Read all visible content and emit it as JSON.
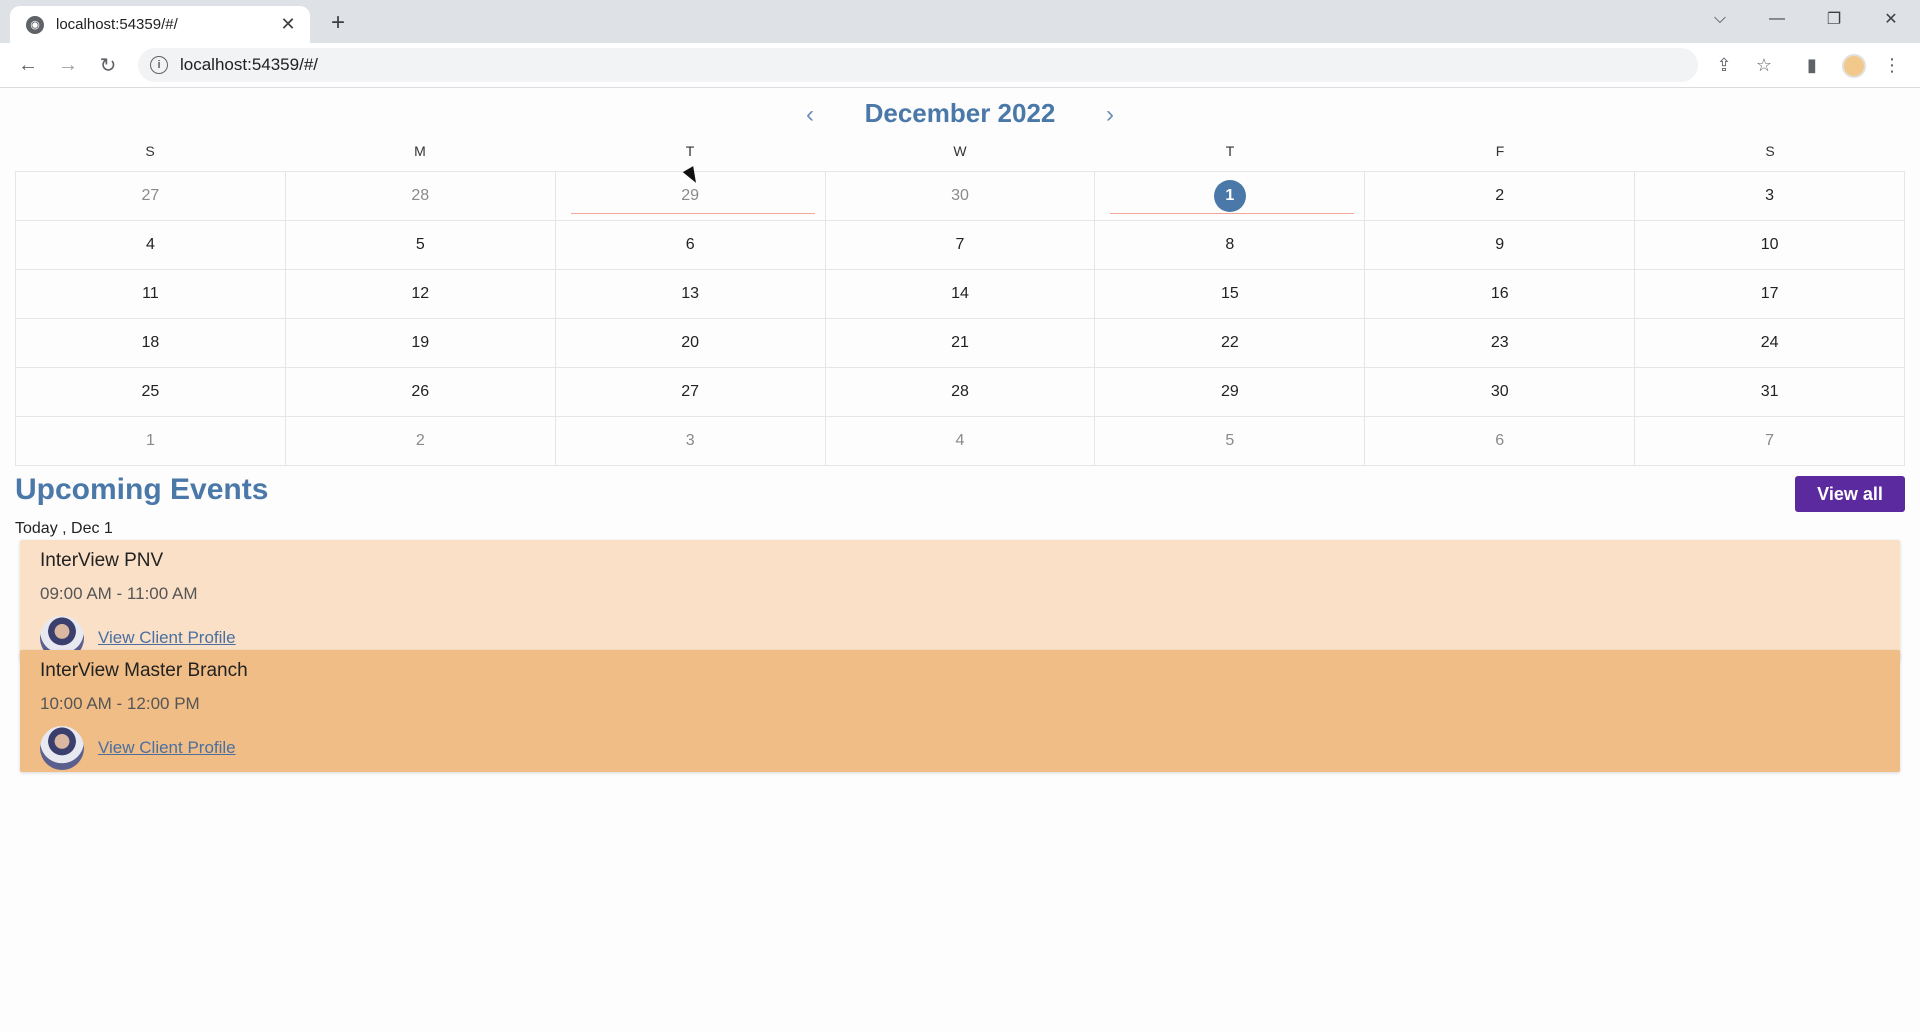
{
  "browser": {
    "tab_title": "localhost:54359/#/",
    "tab_close": "✕",
    "new_tab": "+",
    "url": "localhost:54359/#/",
    "window": {
      "tabsearch": "⌵",
      "minimize": "—",
      "restore": "❐",
      "close": "✕"
    }
  },
  "calendar": {
    "title": "December 2022",
    "prev": "‹",
    "next": "›",
    "weekdays": [
      "S",
      "M",
      "T",
      "W",
      "T",
      "F",
      "S"
    ],
    "weeks": [
      [
        "27",
        "28",
        "29",
        "30",
        "1",
        "2",
        "3"
      ],
      [
        "4",
        "5",
        "6",
        "7",
        "8",
        "9",
        "10"
      ],
      [
        "11",
        "12",
        "13",
        "14",
        "15",
        "16",
        "17"
      ],
      [
        "18",
        "19",
        "20",
        "21",
        "22",
        "23",
        "24"
      ],
      [
        "25",
        "26",
        "27",
        "28",
        "29",
        "30",
        "31"
      ],
      [
        "1",
        "2",
        "3",
        "4",
        "5",
        "6",
        "7"
      ]
    ]
  },
  "events": {
    "title": "Upcoming Events",
    "view_all": "View all",
    "date_label": "Today , Dec 1",
    "items": [
      {
        "title": "InterView PNV",
        "time": "09:00 AM - 11:00 AM",
        "link": "View Client Profile",
        "color": "#fbe0c8"
      },
      {
        "title": "InterView Master Branch",
        "time": "10:00 AM - 12:00 PM",
        "link": "View Client Profile",
        "color": "#f0bd86"
      }
    ]
  },
  "colors": {
    "accent": "#4a78a8",
    "button": "#5b2a9e",
    "today": "#4a78a8"
  }
}
